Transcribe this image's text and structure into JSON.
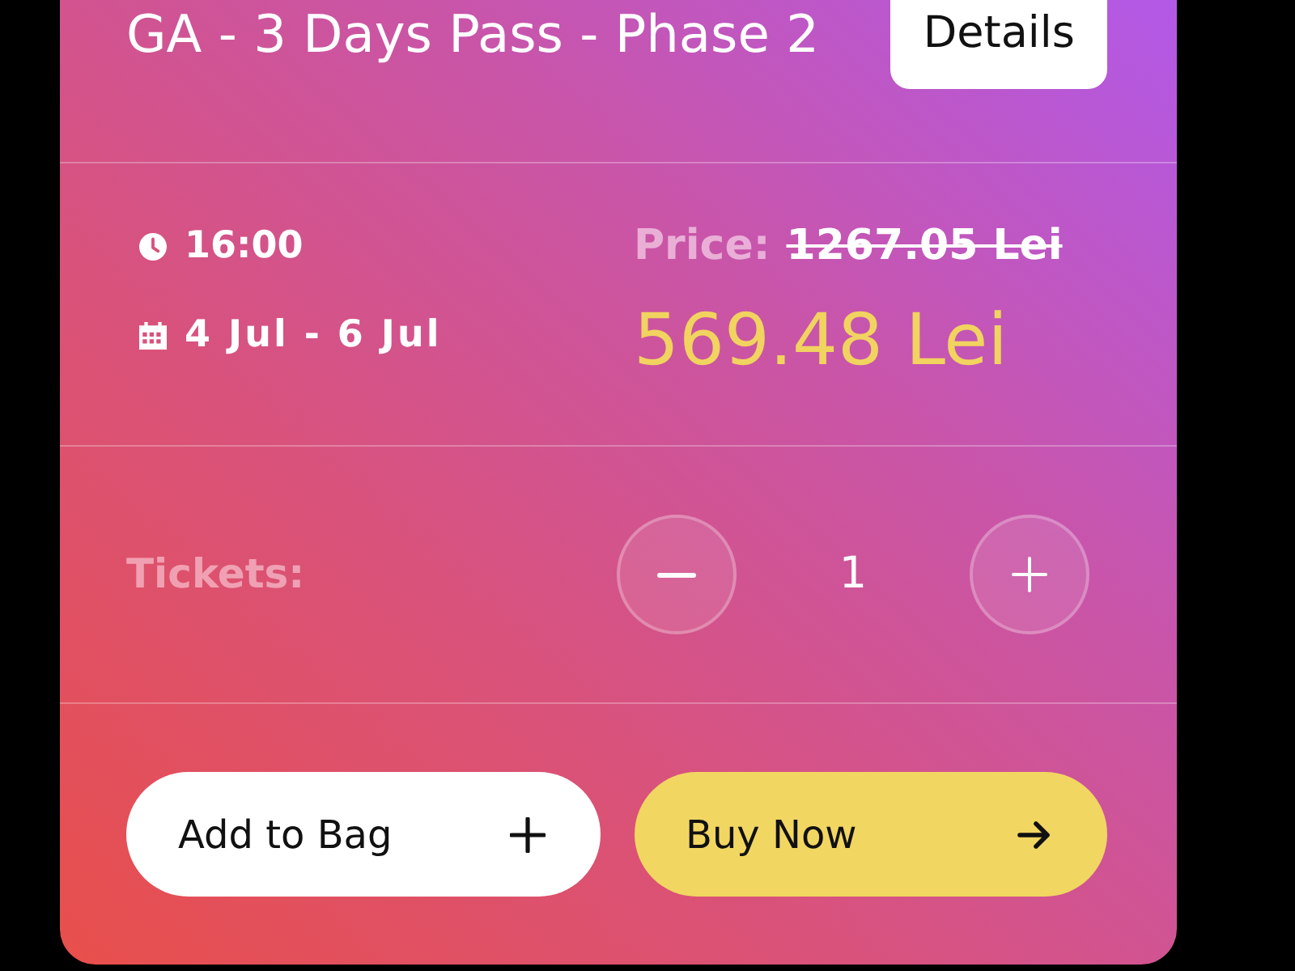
{
  "header": {
    "title": "GA - 3 Days Pass - Phase 2",
    "details_button": "Details"
  },
  "schedule": {
    "time": "16:00",
    "dates": "4 Jul - 6 Jul"
  },
  "price": {
    "label": "Price:",
    "original": "1267.05 Lei",
    "current": "569.48 Lei"
  },
  "tickets": {
    "label": "Tickets:",
    "quantity": "1"
  },
  "actions": [
    {
      "label": "Add to Bag",
      "kind": "add"
    },
    {
      "label": "Buy Now",
      "kind": "buy"
    }
  ]
}
